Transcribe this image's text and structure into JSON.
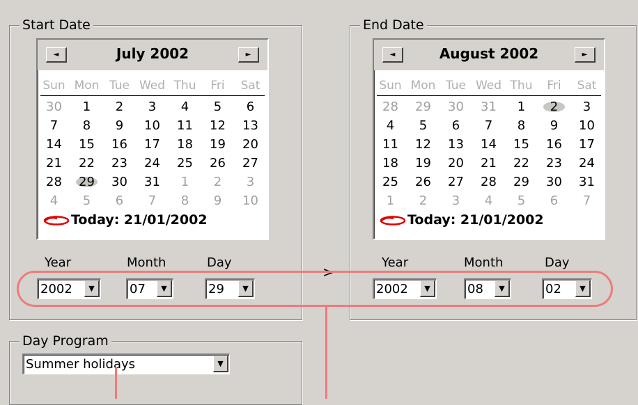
{
  "start": {
    "legend": "Start Date",
    "calendar": {
      "title": "July 2002",
      "weekdays": [
        "Sun",
        "Mon",
        "Tue",
        "Wed",
        "Thu",
        "Fri",
        "Sat"
      ],
      "weeks": [
        [
          "30",
          "1",
          "2",
          "3",
          "4",
          "5",
          "6"
        ],
        [
          "7",
          "8",
          "9",
          "10",
          "11",
          "12",
          "13"
        ],
        [
          "14",
          "15",
          "16",
          "17",
          "18",
          "19",
          "20"
        ],
        [
          "21",
          "22",
          "23",
          "24",
          "25",
          "26",
          "27"
        ],
        [
          "28",
          "29",
          "30",
          "31",
          "1",
          "2",
          "3"
        ],
        [
          "4",
          "5",
          "6",
          "7",
          "8",
          "9",
          "10"
        ]
      ],
      "other_month_cells": [
        "0-0",
        "4-4",
        "4-5",
        "4-6",
        "5-0",
        "5-1",
        "5-2",
        "5-3",
        "5-4",
        "5-5",
        "5-6"
      ],
      "selected_cell": "4-1",
      "today_label": "Today: 21/01/2002",
      "prev_icon": "left-arrow",
      "next_icon": "right-arrow"
    },
    "year_label": "Year",
    "year_value": "2002",
    "month_label": "Month",
    "month_value": "07",
    "day_label": "Day",
    "day_value": "29"
  },
  "end": {
    "legend": "End Date",
    "calendar": {
      "title": "August 2002",
      "weekdays": [
        "Sun",
        "Mon",
        "Tue",
        "Wed",
        "Thu",
        "Fri",
        "Sat"
      ],
      "weeks": [
        [
          "28",
          "29",
          "30",
          "31",
          "1",
          "2",
          "3"
        ],
        [
          "4",
          "5",
          "6",
          "7",
          "8",
          "9",
          "10"
        ],
        [
          "11",
          "12",
          "13",
          "14",
          "15",
          "16",
          "17"
        ],
        [
          "18",
          "19",
          "20",
          "21",
          "22",
          "23",
          "24"
        ],
        [
          "25",
          "26",
          "27",
          "28",
          "29",
          "30",
          "31"
        ],
        [
          "1",
          "2",
          "3",
          "4",
          "5",
          "6",
          "7"
        ]
      ],
      "other_month_cells": [
        "0-0",
        "0-1",
        "0-2",
        "0-3",
        "5-0",
        "5-1",
        "5-2",
        "5-3",
        "5-4",
        "5-5",
        "5-6"
      ],
      "selected_cell": "0-5",
      "today_label": "Today: 21/01/2002",
      "prev_icon": "left-arrow",
      "next_icon": "right-arrow"
    },
    "year_label": "Year",
    "year_value": "2002",
    "month_label": "Month",
    "month_value": "08",
    "day_label": "Day",
    "day_value": "02"
  },
  "separator": ">",
  "day_program": {
    "legend": "Day Program",
    "value": "Summer holidays"
  },
  "colors": {
    "annotation": "#f07a7a",
    "today_marker": "#e00000",
    "background": "#d6d3ce"
  }
}
